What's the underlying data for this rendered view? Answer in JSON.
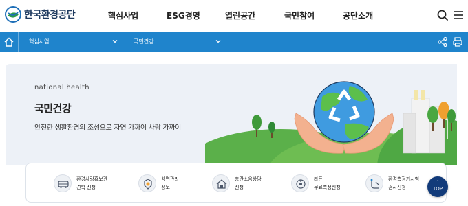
{
  "header": {
    "logo_text": "한국환경공단",
    "nav": [
      "핵심사업",
      "ESG경영",
      "열린공간",
      "국민참여",
      "공단소개"
    ],
    "search_icon": "search-icon",
    "menu_icon": "menu-icon"
  },
  "locbar": {
    "home_icon": "home-icon",
    "level1": "핵심사업",
    "level2": "국민건강",
    "share_icon": "share-icon",
    "print_icon": "print-icon"
  },
  "hero": {
    "subtitle": "national health",
    "title": "국민건강",
    "description": "안전한 생활환경의 조성으로 자연 가까이 사람 가까이"
  },
  "quick_links": [
    {
      "line1": "환경사랑홍보관",
      "line2": "견학 신청",
      "icon": "bus-icon"
    },
    {
      "line1": "석면관리",
      "line2": "정보",
      "icon": "asbestos-icon"
    },
    {
      "line1": "층간소음상담",
      "line2": "신청",
      "icon": "house-icon"
    },
    {
      "line1": "라돈",
      "line2": "무료측정신청",
      "icon": "radon-icon"
    },
    {
      "line1": "환경측정기시험",
      "line2": "검사신청",
      "icon": "measure-icon"
    }
  ],
  "top_button": {
    "label": "TOP",
    "arrow": "⌃"
  },
  "colors": {
    "brand_blue": "#1f84cc",
    "navy": "#123b7a",
    "hero_bg": "#edf1f7"
  }
}
